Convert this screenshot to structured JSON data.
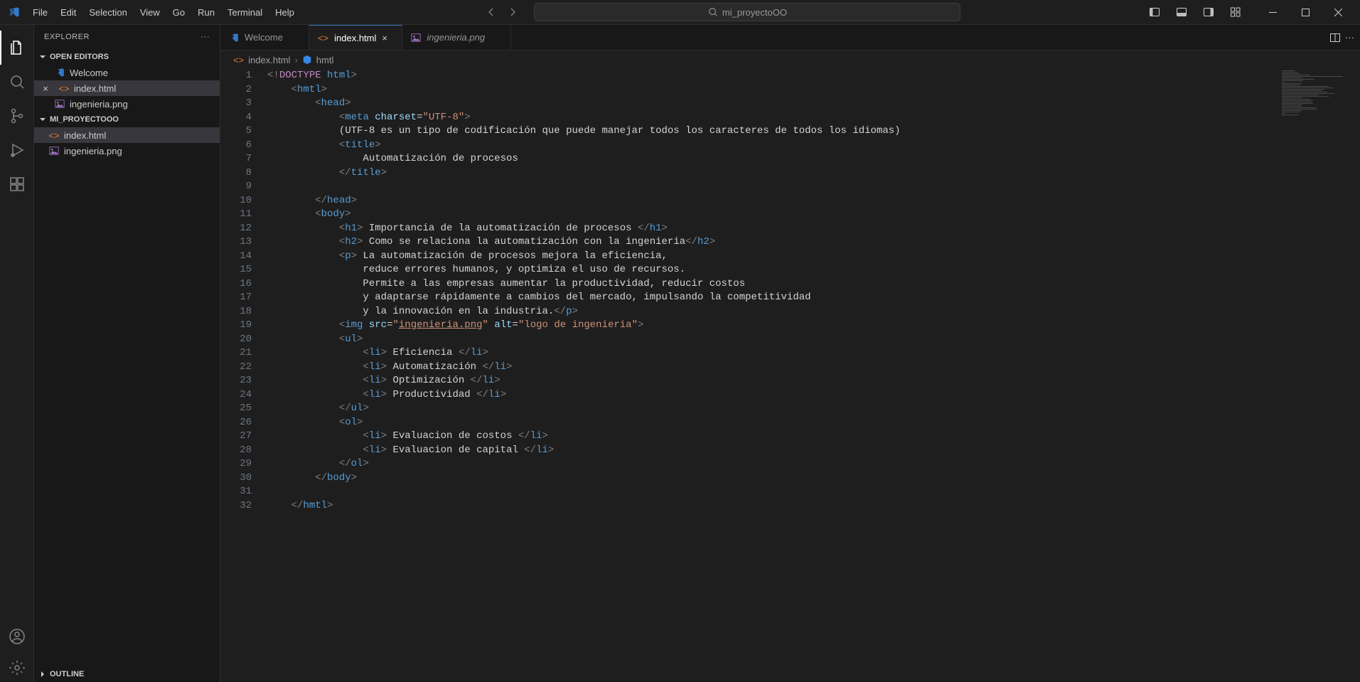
{
  "titlebar": {
    "menu": [
      "File",
      "Edit",
      "Selection",
      "View",
      "Go",
      "Run",
      "Terminal",
      "Help"
    ],
    "search_placeholder": "mi_proyectoOO"
  },
  "sidebar": {
    "title": "EXPLORER",
    "open_editors_label": "OPEN EDITORS",
    "project_label": "MI_PROYECTOOO",
    "outline_label": "OUTLINE",
    "open_editors": [
      {
        "name": "Welcome",
        "icon": "vs"
      },
      {
        "name": "index.html",
        "icon": "html",
        "active": true
      },
      {
        "name": "ingenieria.png",
        "icon": "img"
      }
    ],
    "files": [
      {
        "name": "index.html",
        "icon": "html",
        "active": true
      },
      {
        "name": "ingenieria.png",
        "icon": "img"
      }
    ]
  },
  "tabs": [
    {
      "label": "Welcome",
      "icon": "vs",
      "active": false
    },
    {
      "label": "index.html",
      "icon": "html",
      "active": true
    },
    {
      "label": "ingenieria.png",
      "icon": "img",
      "active": false
    }
  ],
  "breadcrumb": {
    "file": "index.html",
    "symbol": "hmtl"
  },
  "code": {
    "lines_count": 32,
    "lines": [
      [
        {
          "t": "<!",
          "c": "gray"
        },
        {
          "t": "DOCTYPE",
          "c": "doctk"
        },
        {
          "t": " ",
          "c": ""
        },
        {
          "t": "html",
          "c": "doct"
        },
        {
          "t": ">",
          "c": "gray"
        }
      ],
      [
        {
          "t": "    ",
          "c": ""
        },
        {
          "t": "<",
          "c": "gray"
        },
        {
          "t": "hmtl",
          "c": "tag"
        },
        {
          "t": ">",
          "c": "gray"
        }
      ],
      [
        {
          "t": "        ",
          "c": ""
        },
        {
          "t": "<",
          "c": "gray"
        },
        {
          "t": "head",
          "c": "tag"
        },
        {
          "t": ">",
          "c": "gray"
        }
      ],
      [
        {
          "t": "            ",
          "c": ""
        },
        {
          "t": "<",
          "c": "gray"
        },
        {
          "t": "meta",
          "c": "tag"
        },
        {
          "t": " ",
          "c": ""
        },
        {
          "t": "charset",
          "c": "attr"
        },
        {
          "t": "=",
          "c": ""
        },
        {
          "t": "\"UTF-8\"",
          "c": "str"
        },
        {
          "t": ">",
          "c": "gray"
        }
      ],
      [
        {
          "t": "            (UTF-8 es un tipo de codificación que puede manejar todos los caracteres de todos los idiomas)",
          "c": ""
        }
      ],
      [
        {
          "t": "            ",
          "c": ""
        },
        {
          "t": "<",
          "c": "gray"
        },
        {
          "t": "title",
          "c": "tag"
        },
        {
          "t": ">",
          "c": "gray"
        }
      ],
      [
        {
          "t": "                Automatización de procesos",
          "c": ""
        }
      ],
      [
        {
          "t": "            ",
          "c": ""
        },
        {
          "t": "</",
          "c": "gray"
        },
        {
          "t": "title",
          "c": "tag"
        },
        {
          "t": ">",
          "c": "gray"
        }
      ],
      [
        {
          "t": "",
          "c": ""
        }
      ],
      [
        {
          "t": "        ",
          "c": ""
        },
        {
          "t": "</",
          "c": "gray"
        },
        {
          "t": "head",
          "c": "tag"
        },
        {
          "t": ">",
          "c": "gray"
        }
      ],
      [
        {
          "t": "        ",
          "c": ""
        },
        {
          "t": "<",
          "c": "gray"
        },
        {
          "t": "body",
          "c": "tag"
        },
        {
          "t": ">",
          "c": "gray"
        }
      ],
      [
        {
          "t": "            ",
          "c": ""
        },
        {
          "t": "<",
          "c": "gray"
        },
        {
          "t": "h1",
          "c": "tag"
        },
        {
          "t": ">",
          "c": "gray"
        },
        {
          "t": " Importancia de la automatización de procesos ",
          "c": ""
        },
        {
          "t": "</",
          "c": "gray"
        },
        {
          "t": "h1",
          "c": "tag"
        },
        {
          "t": ">",
          "c": "gray"
        }
      ],
      [
        {
          "t": "            ",
          "c": ""
        },
        {
          "t": "<",
          "c": "gray"
        },
        {
          "t": "h2",
          "c": "tag"
        },
        {
          "t": ">",
          "c": "gray"
        },
        {
          "t": " Como se relaciona la automatización con la ingenieria",
          "c": ""
        },
        {
          "t": "</",
          "c": "gray"
        },
        {
          "t": "h2",
          "c": "tag"
        },
        {
          "t": ">",
          "c": "gray"
        }
      ],
      [
        {
          "t": "            ",
          "c": ""
        },
        {
          "t": "<",
          "c": "gray"
        },
        {
          "t": "p",
          "c": "tag"
        },
        {
          "t": ">",
          "c": "gray"
        },
        {
          "t": " La automatización de procesos mejora la eficiencia,",
          "c": ""
        }
      ],
      [
        {
          "t": "                reduce errores humanos, y optimiza el uso de recursos.",
          "c": ""
        }
      ],
      [
        {
          "t": "                Permite a las empresas aumentar la productividad, reducir costos",
          "c": ""
        }
      ],
      [
        {
          "t": "                y adaptarse rápidamente a cambios del mercado, impulsando la competitividad",
          "c": ""
        }
      ],
      [
        {
          "t": "                y la innovación en la industria.",
          "c": ""
        },
        {
          "t": "</",
          "c": "gray"
        },
        {
          "t": "p",
          "c": "tag"
        },
        {
          "t": ">",
          "c": "gray"
        }
      ],
      [
        {
          "t": "            ",
          "c": ""
        },
        {
          "t": "<",
          "c": "gray"
        },
        {
          "t": "img",
          "c": "tag"
        },
        {
          "t": " ",
          "c": ""
        },
        {
          "t": "src",
          "c": "attr"
        },
        {
          "t": "=",
          "c": ""
        },
        {
          "t": "\"",
          "c": "str"
        },
        {
          "t": "ingenieria.png",
          "c": "link"
        },
        {
          "t": "\"",
          "c": "str"
        },
        {
          "t": " ",
          "c": ""
        },
        {
          "t": "alt",
          "c": "attr"
        },
        {
          "t": "=",
          "c": ""
        },
        {
          "t": "\"logo de ingenieria\"",
          "c": "str"
        },
        {
          "t": ">",
          "c": "gray"
        }
      ],
      [
        {
          "t": "            ",
          "c": ""
        },
        {
          "t": "<",
          "c": "gray"
        },
        {
          "t": "ul",
          "c": "tag"
        },
        {
          "t": ">",
          "c": "gray"
        }
      ],
      [
        {
          "t": "                ",
          "c": ""
        },
        {
          "t": "<",
          "c": "gray"
        },
        {
          "t": "li",
          "c": "tag"
        },
        {
          "t": ">",
          "c": "gray"
        },
        {
          "t": " Eficiencia ",
          "c": ""
        },
        {
          "t": "</",
          "c": "gray"
        },
        {
          "t": "li",
          "c": "tag"
        },
        {
          "t": ">",
          "c": "gray"
        }
      ],
      [
        {
          "t": "                ",
          "c": ""
        },
        {
          "t": "<",
          "c": "gray"
        },
        {
          "t": "li",
          "c": "tag"
        },
        {
          "t": ">",
          "c": "gray"
        },
        {
          "t": " Automatización ",
          "c": ""
        },
        {
          "t": "</",
          "c": "gray"
        },
        {
          "t": "li",
          "c": "tag"
        },
        {
          "t": ">",
          "c": "gray"
        }
      ],
      [
        {
          "t": "                ",
          "c": ""
        },
        {
          "t": "<",
          "c": "gray"
        },
        {
          "t": "li",
          "c": "tag"
        },
        {
          "t": ">",
          "c": "gray"
        },
        {
          "t": " Optimización ",
          "c": ""
        },
        {
          "t": "</",
          "c": "gray"
        },
        {
          "t": "li",
          "c": "tag"
        },
        {
          "t": ">",
          "c": "gray"
        }
      ],
      [
        {
          "t": "                ",
          "c": ""
        },
        {
          "t": "<",
          "c": "gray"
        },
        {
          "t": "li",
          "c": "tag"
        },
        {
          "t": ">",
          "c": "gray"
        },
        {
          "t": " Productividad ",
          "c": ""
        },
        {
          "t": "</",
          "c": "gray"
        },
        {
          "t": "li",
          "c": "tag"
        },
        {
          "t": ">",
          "c": "gray"
        }
      ],
      [
        {
          "t": "            ",
          "c": ""
        },
        {
          "t": "</",
          "c": "gray"
        },
        {
          "t": "ul",
          "c": "tag"
        },
        {
          "t": ">",
          "c": "gray"
        }
      ],
      [
        {
          "t": "            ",
          "c": ""
        },
        {
          "t": "<",
          "c": "gray"
        },
        {
          "t": "ol",
          "c": "tag"
        },
        {
          "t": ">",
          "c": "gray"
        }
      ],
      [
        {
          "t": "                ",
          "c": ""
        },
        {
          "t": "<",
          "c": "gray"
        },
        {
          "t": "li",
          "c": "tag"
        },
        {
          "t": ">",
          "c": "gray"
        },
        {
          "t": " Evaluacion de costos ",
          "c": ""
        },
        {
          "t": "</",
          "c": "gray"
        },
        {
          "t": "li",
          "c": "tag"
        },
        {
          "t": ">",
          "c": "gray"
        }
      ],
      [
        {
          "t": "                ",
          "c": ""
        },
        {
          "t": "<",
          "c": "gray"
        },
        {
          "t": "li",
          "c": "tag"
        },
        {
          "t": ">",
          "c": "gray"
        },
        {
          "t": " Evaluacion de capital ",
          "c": ""
        },
        {
          "t": "</",
          "c": "gray"
        },
        {
          "t": "li",
          "c": "tag"
        },
        {
          "t": ">",
          "c": "gray"
        }
      ],
      [
        {
          "t": "            ",
          "c": ""
        },
        {
          "t": "</",
          "c": "gray"
        },
        {
          "t": "ol",
          "c": "tag"
        },
        {
          "t": ">",
          "c": "gray"
        }
      ],
      [
        {
          "t": "        ",
          "c": ""
        },
        {
          "t": "</",
          "c": "gray"
        },
        {
          "t": "body",
          "c": "tag"
        },
        {
          "t": ">",
          "c": "gray"
        }
      ],
      [
        {
          "t": "",
          "c": ""
        }
      ],
      [
        {
          "t": "    ",
          "c": ""
        },
        {
          "t": "</",
          "c": "gray"
        },
        {
          "t": "hmtl",
          "c": "tag"
        },
        {
          "t": ">",
          "c": "gray"
        }
      ]
    ]
  }
}
